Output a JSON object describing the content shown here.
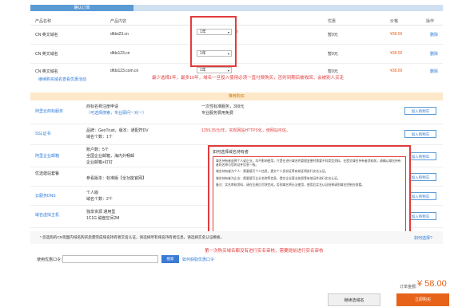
{
  "steps": [
    "确认订单",
    "",
    "",
    ""
  ],
  "table": {
    "headers": [
      "产品名称",
      "产品内容",
      "",
      "",
      "",
      "优惠",
      "价格",
      "操作"
    ]
  },
  "rows": [
    {
      "name": "CN 英文域名",
      "content": "dfdsi23.cn",
      "year": "1年",
      "discount": "暂0元",
      "price": "¥38.00",
      "op": "删除"
    },
    {
      "name": "CN 英文域名",
      "content": "dfds123.cn",
      "year": "1年",
      "discount": "暂0元",
      "price": "¥38.00",
      "op": "删除"
    },
    {
      "name": "CN 英文域名",
      "content": "dfds123.com.cn",
      "year": "1年",
      "discount": "暂0元",
      "price": "¥38.00",
      "op": "删除"
    }
  ],
  "links": {
    "left": "继续购买域名",
    "right": "查看优惠活动"
  },
  "annotations": {
    "top": "最少选择1年，最多10年，域名一旦投入使用必须一直付费购买，否则到期后被收回，会被别人买走",
    "bottom": "第一次购买域名都没有进行实名审核，需要提前进行实名审核"
  },
  "rec": {
    "head": "推荐购买",
    "items": [
      {
        "title": "阿里云商标服务",
        "desc1": "商标名称注册申请",
        "desc2": "（可选择搜索，专业顾问一对一）",
        "mid1": "一次性标准服务，399元",
        "mid2": "专业服务费用免费",
        "btn": "加入购物车"
      },
      {
        "title": "SSL证书",
        "desc1": "品牌：GeoTrust，版本：通配符DV",
        "desc2": "域名个数：1个",
        "mid1": "1259.35元/年，实现网站HTTPS化，使网站可信。",
        "mid2": "",
        "btn": "加入购物车"
      },
      {
        "title": "阿里企业邮箱",
        "desc1": "账户数：5个",
        "desc2": "全国企业邮箱，海内外畅邮",
        "mid1": "企业邮箱+钉钉",
        "mid2": "",
        "btn": "加入购物车"
      },
      {
        "title": "优选建站套餐",
        "desc1": "参看版本：标准版【全功能官网】",
        "desc2": "",
        "mid1": "",
        "mid2": "",
        "btn": "加入购物车"
      },
      {
        "title": "云服务DNS",
        "desc1": "个人版",
        "desc2": "域名个数：2个",
        "mid1": "",
        "mid2": "",
        "btn": "加入购物车"
      },
      {
        "title": "域名虚拟主机",
        "desc1": "独享资源 通用型",
        "desc2": "1C1G 磁盘空间2M",
        "mid1": "",
        "mid2": "",
        "btn": "加入购物车"
      }
    ]
  },
  "popup": {
    "title": "如何选择域名持有者",
    "p1": "域名持有者选择个人或企业，均不影响使用，只是在进行域名的管理变更时需要不同类型资料，在提交域名持有者资料前，请确认域名持有者的名称与您的证件信息一致。",
    "p2": "域名持有者为个人：需要填写个人信息，提交个人身份证等有效证明进行实名认证。",
    "p3": "域名持有者为企业：需要填写企业名称等信息，提交企业营业执照等有效证件进行实名认证。",
    "p4": "备注：实名审核资料，请在注册后尽快完成，否则域名将无法使用，使用后实名认证结果请到域名控制台查看。"
  },
  "notice": "* 您选购的CN等国内域名购买后需完成域名持有者实名认证，请选择所有域名持有者信息，请选择实名认证模板。",
  "notice_link": "如何选择?",
  "coupon": {
    "label": "使用优惠口令:",
    "btn": "搜索",
    "link": "如何获取优惠口令"
  },
  "total": {
    "label": "订单金额:",
    "amount": "¥ 58.00"
  },
  "buttons": {
    "continue": "继续选域名",
    "buy": "立即购买"
  }
}
